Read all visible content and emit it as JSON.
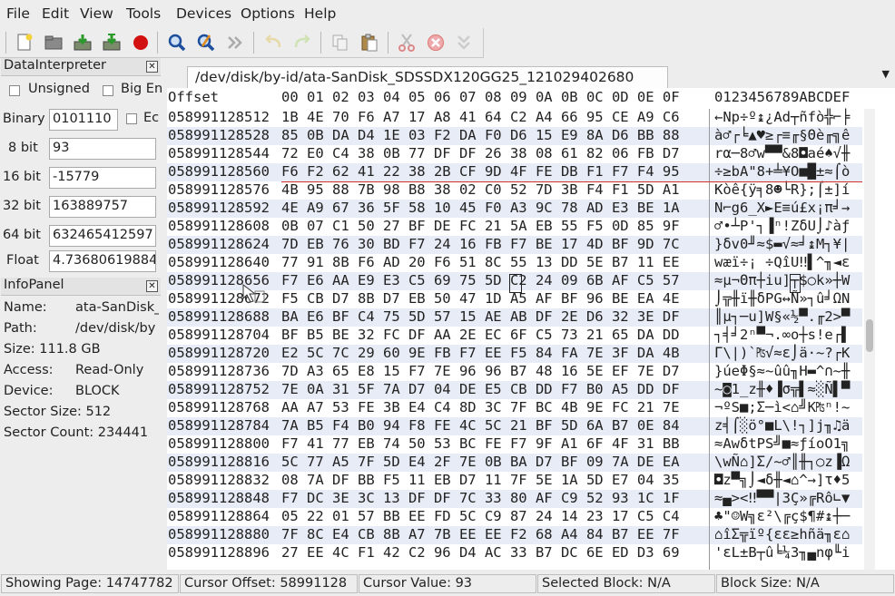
{
  "menu": [
    "File",
    "Edit",
    "View",
    "Tools",
    "Devices",
    "Options",
    "Help"
  ],
  "toolbar_icons": [
    "new-file-icon",
    "open-icon",
    "save-icon",
    "save-as-icon",
    "record-icon",
    "find-icon",
    "find-replace-icon",
    "goto-icon",
    "undo-icon",
    "redo-icon",
    "copy-icon",
    "paste-icon",
    "cut-icon",
    "delete-icon",
    "insert-icon"
  ],
  "data_interpreter": {
    "title": "DataInterpreter",
    "unsigned_label": "Unsigned",
    "big_endian_label": "Big En",
    "binary_label": "Binary",
    "binary_value": "0101110",
    "ec_label": "Ec",
    "bit8_label": "8 bit",
    "bit8_value": "93",
    "bit16_label": "16 bit",
    "bit16_value": "-15779",
    "bit32_label": "32 bit",
    "bit32_value": "163889757",
    "bit64_label": "64 bit",
    "bit64_value": "632465412597",
    "float_label": "Float",
    "float_value": "4.736806198847"
  },
  "info_panel": {
    "title": "InfoPanel",
    "name_label": "Name:",
    "name_value": "ata-SanDisk_",
    "path_label": "Path:",
    "path_value": "/dev/disk/by",
    "size_label": "Size: 111.8 GB",
    "access_label": "Access:",
    "access_value": "Read-Only",
    "device_label": "Device:",
    "device_value": "BLOCK",
    "sector_size_label": "Sector Size: 512",
    "sector_count_label": "Sector Count: 234441"
  },
  "tab": {
    "title": "/dev/disk/by-id/ata-SanDisk_SDSSDX120GG25_121029402680"
  },
  "hex_header": {
    "offset": "Offset",
    "hex": "00 01 02 03 04 05 06 07 08 09 0A 0B 0C 0D 0E 0F",
    "ascii": "0123456789ABCDEF"
  },
  "rows": [
    {
      "off": "058991128512",
      "hex": "1B 4E 70 F6 A7 17 A8 41 64 C2 A4 66 95 CE A9 C6",
      "asc": "←Np÷º↨¿Ad┬ñfò╬⌐╞"
    },
    {
      "off": "058991128528",
      "hex": "85 0B DA D4 1E 03 F2 DA F0 D6 15 E9 8A D6 BB 88",
      "asc": "à♂┌╘▲♥≥┌≡╓§Θè╓╗ê"
    },
    {
      "off": "058991128544",
      "hex": "72 E0 C4 38 0B 77 DF DF 26 38 08 61 82 06 FB D7",
      "asc": "rα─8♂w▀▀&8◘aé♠√╫"
    },
    {
      "off": "058991128560",
      "hex": "F6 F2 62 41 22 38 2B CF 9D 4F FE DB F1 F7 F4 95",
      "asc": "÷≥bA\"8+╧¥O■█±≈⌠ò"
    },
    {
      "off": "058991128576",
      "hex": "4B 95 88 7B 98 B8 38 02 C0 52 7D 3B F4 F1 5D A1",
      "asc": "Kòê{ÿ╕8☻└R};⌠±]í"
    },
    {
      "off": "058991128592",
      "hex": "4E A9 67 36 5F 58 10 45 F0 A3 9C 78 AD E3 BE 1A",
      "asc": "N⌐g6_X►E≡ú£x¡π╛→"
    },
    {
      "off": "058991128608",
      "hex": "0B 07 C1 50 27 BF DE FC 21 5A EB 55 F5 0D 85 9F",
      "asc": "♂•┴P'┐▐ⁿ!ZδU⌡♪àƒ"
    },
    {
      "off": "058991128624",
      "hex": "7D EB 76 30 BD F7 24 16 FB F7 BE 17 4D BF 9D 7C",
      "asc": "}δv0╜≈$▬√≈╛↨M┐¥|"
    },
    {
      "off": "058991128640",
      "hex": "77 91 8B F6 AD 20 F6 51 8C 55 13 DD 5E B7 11 EE",
      "asc": "wæï÷¡ ÷QîU‼▌^╖◄ε"
    },
    {
      "off": "058991128656",
      "hex": "F7 E6 AA E9 E3 C5 69 75 5D C2 24 09 6B AF C5 57",
      "asc": "≈µ¬Θπ┼iu]┬$○k»┼W"
    },
    {
      "off": "058991128672",
      "hex": "F5 CB D7 8B D7 EB 50 47 1D A5 AF BF 96 BE EA 4E",
      "asc": "⌡╦╫ï╫δPG↔Ñ»┐û╛ΩN"
    },
    {
      "off": "058991128688",
      "hex": "BA E6 BF C4 75 5D 57 15 AE AB DF 2E D6 32 3E DF",
      "asc": "║µ┐─u]W§«½▀.╓2>▀"
    },
    {
      "off": "058991128704",
      "hex": "BF B5 BE 32 FC DF AA 2E EC 6F C5 73 21 65 DA DD",
      "asc": "┐╡╛2ⁿ▀¬.∞o┼s!e┌▌"
    },
    {
      "off": "058991128720",
      "hex": "E2 5C 7C 29 60 9E FB F7 EE F5 84 FA 7E 3F DA 4B",
      "asc": "Γ\\|)`₧√≈ε⌡ä·~?┌K"
    },
    {
      "off": "058991128736",
      "hex": "7D A3 65 E8 15 F7 7E 96 96 B7 48 16 5E EF 7E D7",
      "asc": "}úeΦ§≈~ûû╖H▬^∩~╫"
    },
    {
      "off": "058991128752",
      "hex": "7E 0A 31 5F 7A D7 04 DE E5 CB DD F7 B0 A5 DD DF",
      "asc": "~◙1_z╫♦▐σ╦▌≈░Ñ▌▀"
    },
    {
      "off": "058991128768",
      "hex": "AA A7 53 FE 3B E4 C4 8D 3C 7F BC 4B 9E FC 21 7E",
      "asc": "¬ºS■;Σ─ì<⌂╝K₧ⁿ!~"
    },
    {
      "off": "058991128784",
      "hex": "7A B5 F4 B0 94 F8 FE 4C 5C 21 BF 5D 6A B7 0E 84",
      "asc": "z╡⌠░ö°■L\\!┐]j╖♫ä"
    },
    {
      "off": "058991128800",
      "hex": "F7 41 77 EB 74 50 53 BC FE F7 9F A1 6F 4F 31 BB",
      "asc": "≈AwδtPS╝■≈ƒíoO1╗"
    },
    {
      "off": "058991128816",
      "hex": "5C 77 A5 7F 5D E4 2F 7E 0B BA D7 BF 09 7A DE EA",
      "asc": "\\wÑ⌂]Σ/~♂║╫┐○z▐Ω"
    },
    {
      "off": "058991128832",
      "hex": "08 7A DF BB F5 11 EB D7 11 7F 5E 1A 5D E7 04 35",
      "asc": "◘z▀╗⌡◄δ╫◄⌂^→]τ♦5"
    },
    {
      "off": "058991128848",
      "hex": "F7 DC 3E 3C 13 DF DF 7C 33 80 AF C9 52 93 1C 1F",
      "asc": "≈▄><‼▀▀|3Ç»╔Rô∟▼"
    },
    {
      "off": "058991128864",
      "hex": "05 22 01 57 BB EE FD 5C C9 87 24 14 23 17 C5 C4",
      "asc": "♣\"☺W╗ε²\\╔ç$¶#↨┼─"
    },
    {
      "off": "058991128880",
      "hex": "7F 8C E4 CB 8B A7 7B EE EE F2 68 A4 84 B7 EE 7F",
      "asc": "⌂îΣ╦ïº{εε≥hñä╖ε⌂"
    },
    {
      "off": "058991128896",
      "hex": "27 EE 4C F1 42 C2 96 D4 AC 33 B7 DC 6E ED D3 69",
      "asc": "'εL±B┬û╘¼3╖▄nφ╙i"
    }
  ],
  "status": {
    "page": "Showing Page: 14747782",
    "cursor_offset": "Cursor Offset: 58991128",
    "cursor_value": "Cursor Value: 93",
    "selected_block": "Selected Block: N/A",
    "block_size": "Block Size: N/A"
  }
}
